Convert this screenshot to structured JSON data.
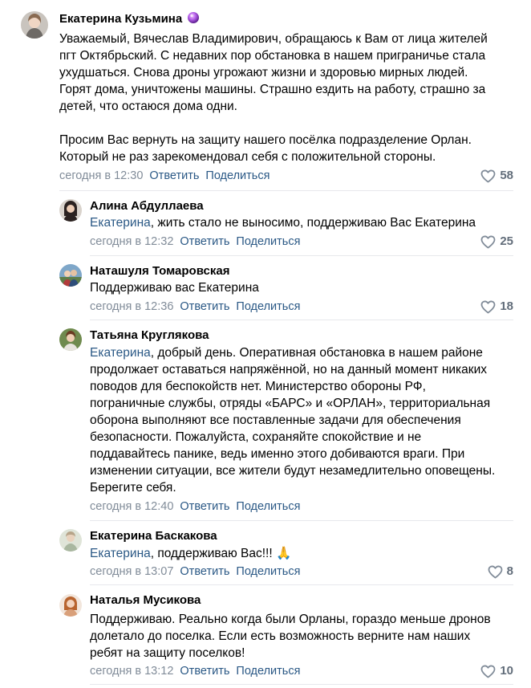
{
  "actions": {
    "reply": "Ответить",
    "share": "Поделиться"
  },
  "colors": {
    "link": "#2a5885",
    "meta": "#818c99",
    "likes": "#626d7a",
    "divider": "#e7e8ec"
  },
  "comments": [
    {
      "author": "Екатерина Кузьмина",
      "badge_icon": "purple-orb-icon",
      "text_lines": [
        "Уважаемый, Вячеслав Владимирович, обращаюсь к Вам от лица жителей",
        "пгт Октябрьский. С недавних пор обстановка в нашем приграничье стала",
        "ухудшаться. Снова дроны угрожают жизни и здоровью мирных людей.",
        "Горят дома, уничтожены машины. Страшно ездить на работу, страшно за",
        "детей, что остаюся дома одни.",
        "",
        "Просим Вас вернуть на защиту нашего посёлка подразделение Орлан.",
        "Который не раз зарекомендовал себя с положительной стороны."
      ],
      "time": "сегодня в 12:30",
      "likes": "58"
    },
    {
      "author": "Алина Абдуллаева",
      "mention": "Екатерина",
      "text_lines": [
        ", жить стало не выносимо, поддерживаю Вас Екатерина"
      ],
      "time": "сегодня в 12:32",
      "likes": "25"
    },
    {
      "author": "Наташуля Томаровская",
      "text_lines": [
        "Поддерживаю вас Екатерина"
      ],
      "time": "сегодня в 12:36",
      "likes": "18"
    },
    {
      "author": "Татьяна Круглякова",
      "mention": "Екатерина",
      "text_lines": [
        ", добрый день. Оперативная обстановка в нашем районе",
        "продолжает оставаться напряжённой, но на данный момент никаких",
        "поводов для беспокойств нет. Министерство обороны РФ,",
        "пограничные службы, отряды «БАРС» и «ОРЛАН», территориальная",
        "оборона выполняют все поставленные задачи для обеспечения",
        "безопасности. Пожалуйста, сохраняйте спокойствие и не",
        "поддавайтесь панике, ведь именно этого добиваются враги. При",
        "изменении ситуации, все жители будут незамедлительно оповещены.",
        "Берегите себя."
      ],
      "time": "сегодня в 12:40",
      "likes": ""
    },
    {
      "author": "Екатерина Баскакова",
      "mention": "Екатерина",
      "text_lines": [
        ", поддерживаю Вас!!! 🙏"
      ],
      "time": "сегодня в 13:07",
      "likes": "8"
    },
    {
      "author": "Наталья Мусикова",
      "text_lines": [
        "Поддерживаю. Реально когда были Орланы, гораздо меньше дронов",
        "долетало до поселка. Если есть возможность верните нам наших",
        "ребят на защиту поселков!"
      ],
      "time": "сегодня в 13:12",
      "likes": "10"
    }
  ]
}
